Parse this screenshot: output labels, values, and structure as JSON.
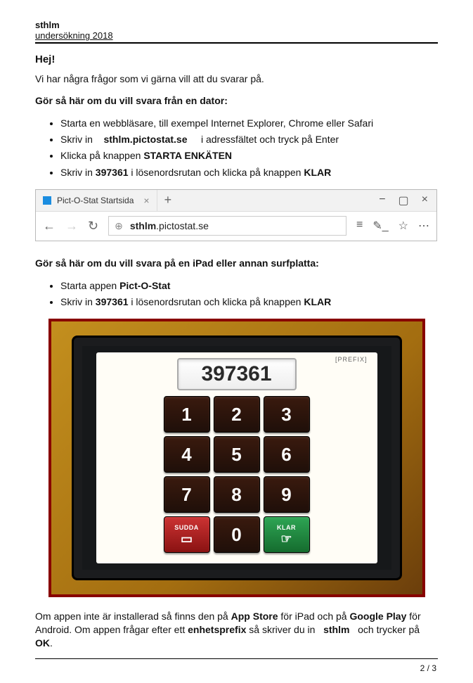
{
  "header": {
    "brand": "sthlm",
    "subtitle": "undersökning 2018"
  },
  "greeting": "Hej!",
  "intro": "Vi har några frågor som vi gärna vill att du svarar på.",
  "computer_heading": "Gör så här om du vill svara från en dator:",
  "steps_computer": {
    "s1": "Starta en webbläsare, till exempel Internet Explorer, Chrome eller Safari",
    "s2a": "Skriv in",
    "s2b_bold": "sthlm.pictostat.se",
    "s2c": "i adressfältet och tryck på Enter",
    "s3a": "Klicka på knappen",
    "s3b_bold": "STARTA ENKÄTEN",
    "s4a": "Skriv in",
    "s4b_bold": "397361",
    "s4c": "i lösenordsrutan och klicka på knappen",
    "s4d_bold": "KLAR"
  },
  "browser": {
    "tab_title": "Pict-O-Stat Startsida",
    "url_prefix_bold": "sthlm",
    "url_rest": ".pictostat.se"
  },
  "ipad_heading": "Gör så här om du vill svara på en iPad eller annan surfplatta:",
  "steps_ipad": {
    "s1a": "Starta appen",
    "s1b_bold": "Pict-O-Stat",
    "s2a": "Skriv in",
    "s2b_bold": "397361",
    "s2c": "i lösenordsrutan och klicka på knappen",
    "s2d_bold": "KLAR"
  },
  "keypad": {
    "prefix_label": "[PREFIX]",
    "entered": "397361",
    "keys": [
      "1",
      "2",
      "3",
      "4",
      "5",
      "6",
      "7",
      "8",
      "9"
    ],
    "erase_label": "SUDDA",
    "zero": "0",
    "ok_label": "KLAR"
  },
  "app_info": {
    "t1": "Om appen inte är installerad så finns den på",
    "t2_bold": "App Store",
    "t3": "för iPad och på",
    "t4_bold": "Google Play",
    "t5": "för Android. Om appen frågar efter ett",
    "t6_bold": "enhetsprefix",
    "t7": "så skriver du in",
    "t8_bold": "sthlm",
    "t9": "och trycker på",
    "t10_bold": "OK",
    "t11": "."
  },
  "page_number": "2 / 3"
}
